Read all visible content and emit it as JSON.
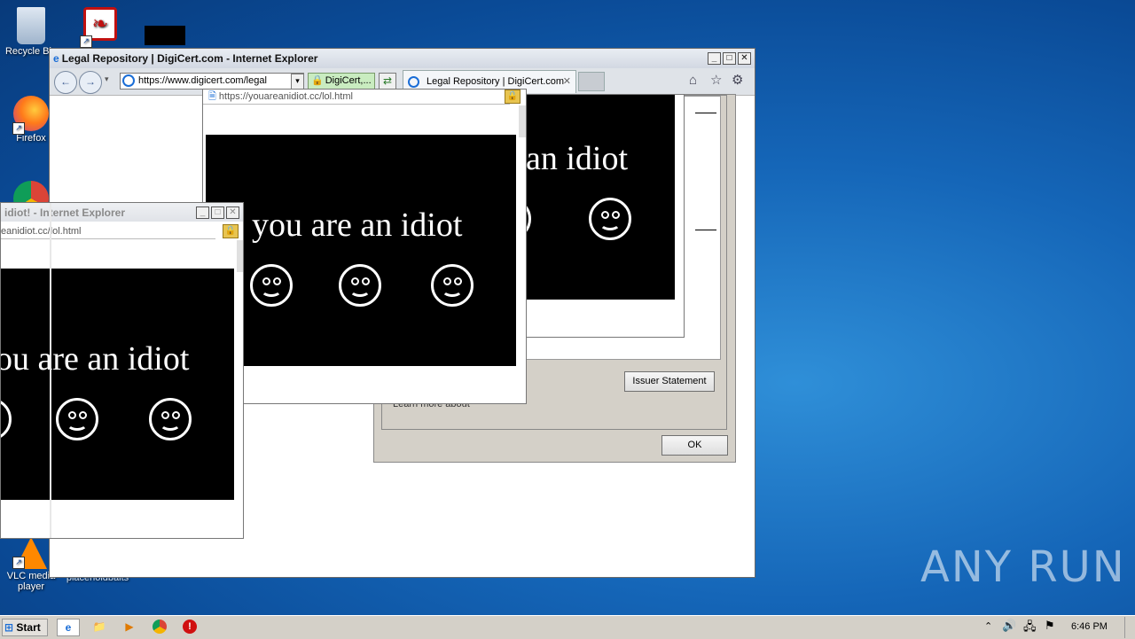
{
  "desktop": {
    "icons": [
      {
        "label": "Recycle Bin",
        "glyph": "recycle-bin-icon"
      },
      {
        "label": "",
        "glyph": "acrobat-reader-icon"
      },
      {
        "label": "Firefox",
        "glyph": "firefox-icon"
      },
      {
        "label": "",
        "glyph": "chrome-icon"
      },
      {
        "label": "VLC media player",
        "glyph": "vlc-icon"
      },
      {
        "label": "placeholdbaits",
        "glyph": "file-icon"
      }
    ],
    "watermark": "ANY RUN"
  },
  "ie_main": {
    "title": "Legal Repository | DigiCert.com - Internet Explorer",
    "address": "https://www.digicert.com/legal",
    "cert_label": "DigiCert,...",
    "tab_label": "Legal Repository | DigiCert.com"
  },
  "cert_dialog": {
    "issuer_statement": "Issuer Statement",
    "learn_more": "Learn more about",
    "ok": "OK"
  },
  "popup_center": {
    "url": "https://youareanidiot.cc/lol.html",
    "message": "you are an idiot"
  },
  "popup_back": {
    "message": "an idiot"
  },
  "popup_left": {
    "title": "idiot! - Internet Explorer",
    "url": "eanidiot.cc/lol.html",
    "message": "ou are an idiot"
  },
  "taskbar": {
    "start": "Start",
    "clock": "6:46 PM"
  }
}
